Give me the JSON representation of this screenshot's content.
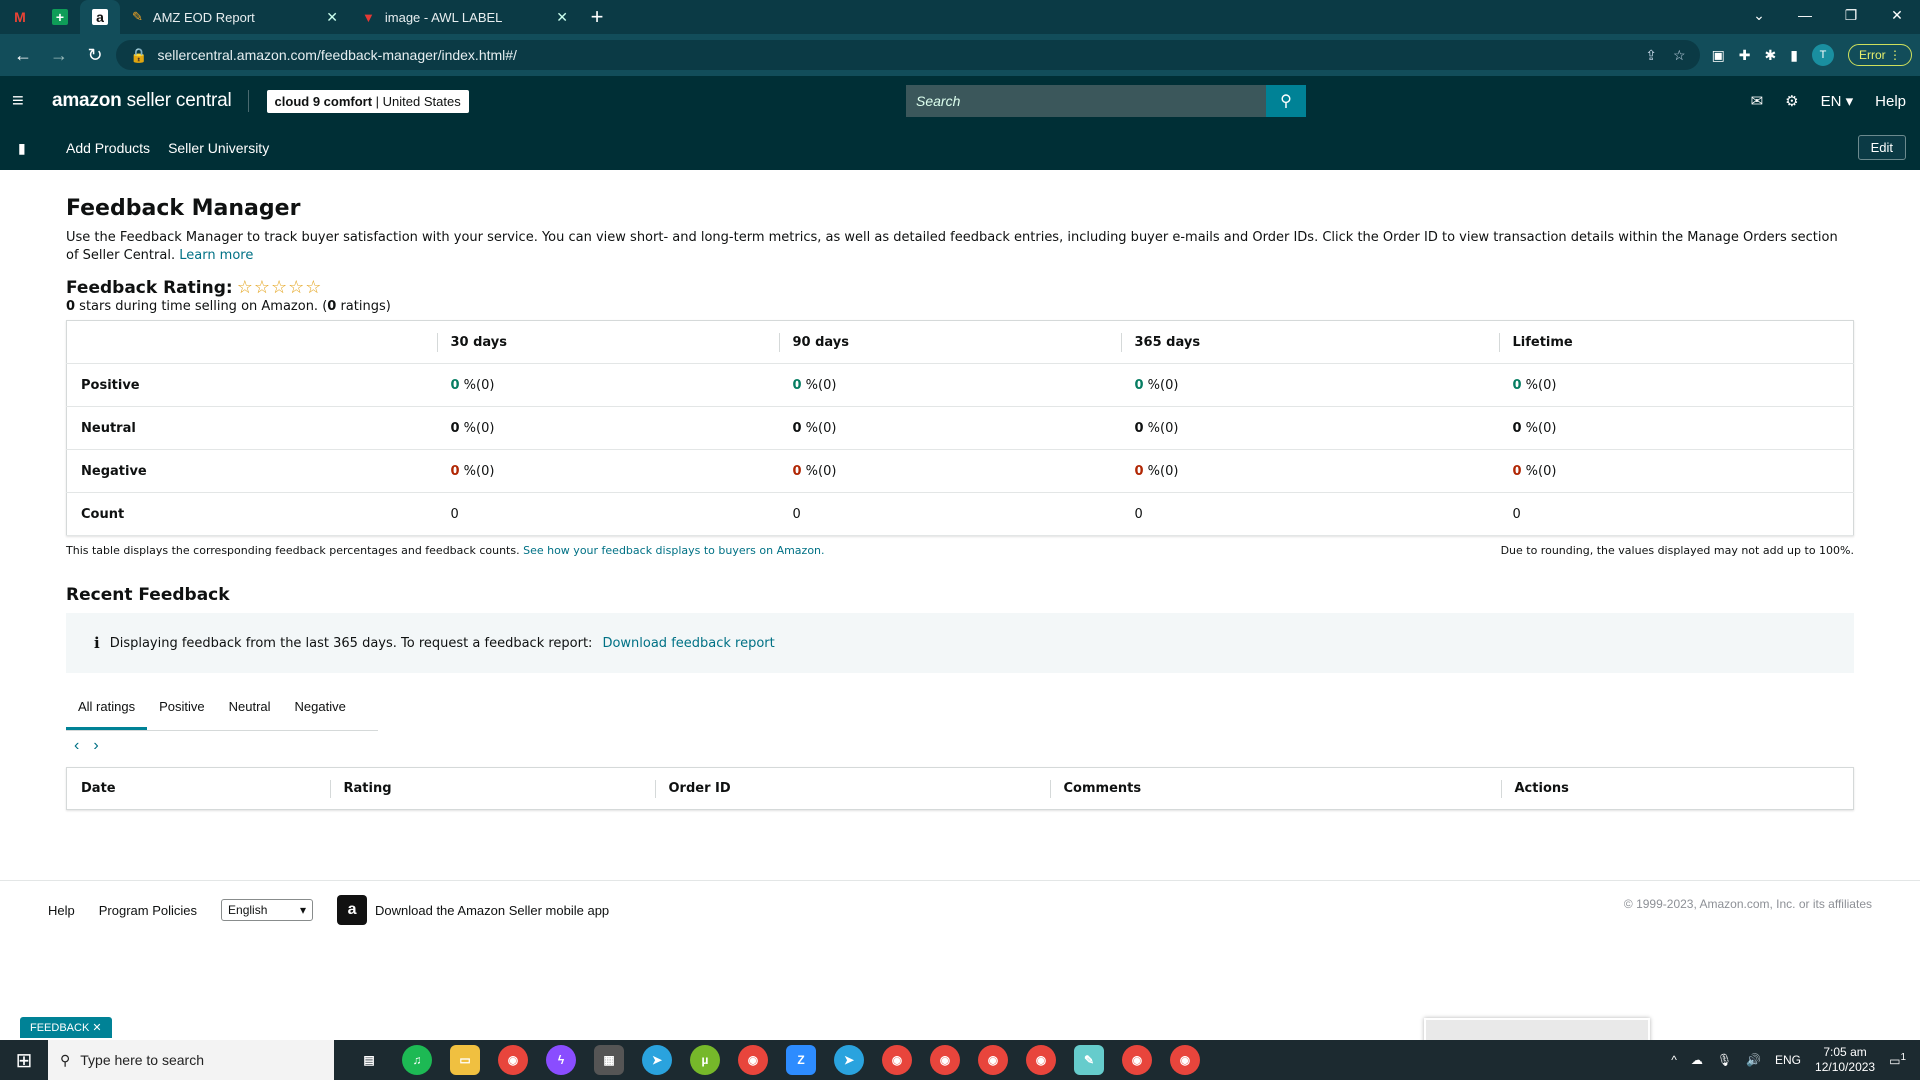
{
  "browser": {
    "tabs": [
      {
        "title": "AMZ EOD Report",
        "active": false
      },
      {
        "title": "image - AWL LABEL",
        "active": false
      }
    ],
    "pinned_tabs": [
      "gmail-icon",
      "sheets-icon",
      "amazon-icon"
    ],
    "url": "sellercentral.amazon.com/feedback-manager/index.html#/",
    "error_label": "Error",
    "profile_initial": "T"
  },
  "amazon_nav": {
    "logo_bold": "amazon",
    "logo_rest": " seller central",
    "account_name": "cloud 9 comfort",
    "account_region": "United States",
    "search_placeholder": "Search",
    "language": "EN",
    "help_label": "Help"
  },
  "sub_nav": {
    "items": [
      "Add Products",
      "Seller University"
    ],
    "edit_label": "Edit"
  },
  "page": {
    "title": "Feedback Manager",
    "description": "Use the Feedback Manager to track buyer satisfaction with your service. You can view short- and long-term metrics, as well as detailed feedback entries, including buyer e-mails and Order IDs. Click the Order ID to view transaction details within the Manage Orders section of Seller Central.",
    "learn_more": "Learn more",
    "rating_label": "Feedback Rating:",
    "stars_value": "0",
    "stars_text": " stars during time selling on Amazon. (",
    "ratings_count": "0",
    "ratings_text": " ratings)"
  },
  "feedback_table": {
    "headers": [
      "30 days",
      "90 days",
      "365 days",
      "Lifetime"
    ],
    "rows": [
      {
        "label": "Positive",
        "cells": [
          {
            "v": "0",
            "r": " %(0)"
          },
          {
            "v": "0",
            "r": " %(0)"
          },
          {
            "v": "0",
            "r": " %(0)"
          },
          {
            "v": "0",
            "r": " %(0)"
          }
        ]
      },
      {
        "label": "Neutral",
        "cells": [
          {
            "v": "0",
            "r": " %(0)"
          },
          {
            "v": "0",
            "r": " %(0)"
          },
          {
            "v": "0",
            "r": " %(0)"
          },
          {
            "v": "0",
            "r": " %(0)"
          }
        ]
      },
      {
        "label": "Negative",
        "cells": [
          {
            "v": "0",
            "r": " %(0)"
          },
          {
            "v": "0",
            "r": " %(0)"
          },
          {
            "v": "0",
            "r": " %(0)"
          },
          {
            "v": "0",
            "r": " %(0)"
          }
        ]
      },
      {
        "label": "Count",
        "cells": [
          {
            "v": "0",
            "r": ""
          },
          {
            "v": "0",
            "r": ""
          },
          {
            "v": "0",
            "r": ""
          },
          {
            "v": "0",
            "r": ""
          }
        ]
      }
    ],
    "footnote_left": "This table displays the corresponding feedback percentages and feedback counts.",
    "footnote_link": "See how your feedback displays to buyers on Amazon.",
    "footnote_right": "Due to rounding, the values displayed may not add up to 100%."
  },
  "recent": {
    "title": "Recent Feedback",
    "info_text": "Displaying feedback from the last 365 days. To request a feedback report:",
    "info_link": "Download feedback report",
    "tabs": [
      "All ratings",
      "Positive",
      "Neutral",
      "Negative"
    ],
    "active_tab": "All ratings",
    "columns": [
      "Date",
      "Rating",
      "Order ID",
      "Comments",
      "Actions"
    ]
  },
  "footer": {
    "help": "Help",
    "policies": "Program Policies",
    "language": "English",
    "app_text": "Download the Amazon Seller mobile app",
    "copyright": "© 1999-2023, Amazon.com, Inc. or its affiliates"
  },
  "feedback_tab_label": "FEEDBACK",
  "taskbar": {
    "search_placeholder": "Type here to search",
    "lang": "ENG",
    "time": "7:05 am",
    "date": "12/10/2023",
    "notification_count": "1"
  },
  "colors": {
    "positive": "#067d62",
    "negative": "#b12704",
    "accent": "#008296",
    "nav_bg": "#002f36"
  }
}
